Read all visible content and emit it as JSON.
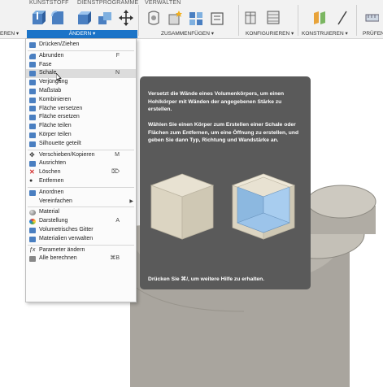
{
  "toolbar": {
    "tabs": [
      {
        "label": "KUNSTSTOFF"
      },
      {
        "label": "DIENSTPROGRAMME"
      },
      {
        "label": "VERWALTEN"
      }
    ],
    "groups": {
      "left_partial": "EREN ▾",
      "andern": "ÄNDERN ▾",
      "zusammenfugen": "ZUSAMMENFÜGEN ▾",
      "konfigurieren": "KONFIGURIEREN ▾",
      "konstruieren": "KONSTRUIEREN ▾",
      "prufen": "PRÜFEN"
    }
  },
  "menu": {
    "items": [
      {
        "label": "Drücken/Ziehen",
        "shortcut": "",
        "icon": "press-pull-icon",
        "color": "#4a7fc1"
      },
      {
        "label": "Abrunden",
        "shortcut": "F",
        "icon": "fillet-icon",
        "color": "#4a7fc1"
      },
      {
        "label": "Fase",
        "shortcut": "",
        "icon": "chamfer-icon",
        "color": "#4a7fc1"
      },
      {
        "label": "Schale",
        "shortcut": "N",
        "icon": "shell-icon",
        "color": "#4a7fc1"
      },
      {
        "label": "Verjüngung",
        "shortcut": "",
        "icon": "draft-icon",
        "color": "#4a7fc1"
      },
      {
        "label": "Maßstab",
        "shortcut": "",
        "icon": "scale-icon",
        "color": "#4a7fc1"
      },
      {
        "label": "Kombinieren",
        "shortcut": "",
        "icon": "combine-icon",
        "color": "#4a7fc1"
      },
      {
        "label": "Fläche versetzen",
        "shortcut": "",
        "icon": "offset-face-icon",
        "color": "#4a7fc1"
      },
      {
        "label": "Fläche ersetzen",
        "shortcut": "",
        "icon": "replace-face-icon",
        "color": "#4a7fc1"
      },
      {
        "label": "Fläche teilen",
        "shortcut": "",
        "icon": "split-face-icon",
        "color": "#4a7fc1"
      },
      {
        "label": "Körper teilen",
        "shortcut": "",
        "icon": "split-body-icon",
        "color": "#4a7fc1"
      },
      {
        "label": "Silhouette geteilt",
        "shortcut": "",
        "icon": "silhouette-split-icon",
        "color": "#4a7fc1"
      },
      {
        "label": "Verschieben/Kopieren",
        "shortcut": "M",
        "icon": "move-icon",
        "color": "#333333"
      },
      {
        "label": "Ausrichten",
        "shortcut": "",
        "icon": "align-icon",
        "color": "#4a7fc1"
      },
      {
        "label": "Löschen",
        "shortcut": "⌦",
        "icon": "delete-icon",
        "color": "#d32f2f"
      },
      {
        "label": "Entfernen",
        "shortcut": "",
        "icon": "remove-icon",
        "color": "#333333"
      },
      {
        "label": "Anordnen",
        "shortcut": "",
        "icon": "arrange-icon",
        "color": "#4a7fc1"
      },
      {
        "label": "Vereinfachen",
        "shortcut": "",
        "icon": "simplify-icon",
        "color": "",
        "submenu": true
      },
      {
        "label": "Material",
        "shortcut": "",
        "icon": "material-icon",
        "color": "#777777"
      },
      {
        "label": "Darstellung",
        "shortcut": "A",
        "icon": "appearance-icon",
        "color": "#e0a020"
      },
      {
        "label": "Volumetrisches Gitter",
        "shortcut": "",
        "icon": "volumetric-lattice-icon",
        "color": "#4a7fc1"
      },
      {
        "label": "Materialien verwalten",
        "shortcut": "",
        "icon": "manage-materials-icon",
        "color": "#4a7fc1"
      },
      {
        "label": "Parameter ändern",
        "shortcut": "",
        "icon": "parameters-icon",
        "color": "#333333"
      },
      {
        "label": "Alle berechnen",
        "shortcut": "⌘B",
        "icon": "compute-all-icon",
        "color": "#333333"
      }
    ]
  },
  "tooltip": {
    "description": "Versetzt die Wände eines Volumenkörpers, um einen Hohlkörper mit Wänden der angegebenen Stärke zu erstellen.",
    "instructions": "Wählen Sie einen Körper zum Erstellen einer Schale oder Flächen zum Entfernen, um eine Öffnung zu erstellen, und geben Sie dann Typ, Richtung und Wandstärke an.",
    "help": "Drücken Sie ⌘/, um weitere Hilfe zu erhalten."
  }
}
